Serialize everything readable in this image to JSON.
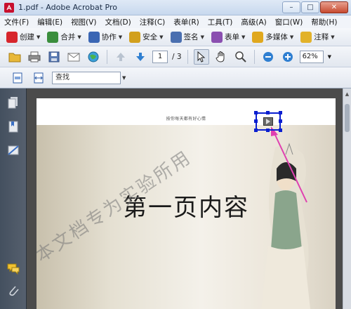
{
  "window": {
    "title": "1.pdf - Adobe Acrobat Pro",
    "minimize": "–",
    "maximize": "□",
    "close": "✕"
  },
  "menu": [
    "文件(F)",
    "编辑(E)",
    "视图(V)",
    "文档(D)",
    "注释(C)",
    "表单(R)",
    "工具(T)",
    "高级(A)",
    "窗口(W)",
    "帮助(H)"
  ],
  "tasks": [
    {
      "label": "创建",
      "icon": "create-icon",
      "color": "#d7262c"
    },
    {
      "label": "合并",
      "icon": "combine-icon",
      "color": "#3b8e3d"
    },
    {
      "label": "协作",
      "icon": "collaborate-icon",
      "color": "#3a66b4"
    },
    {
      "label": "安全",
      "icon": "lock-icon",
      "color": "#d2a01d"
    },
    {
      "label": "签名",
      "icon": "pen-icon",
      "color": "#4a6fb0"
    },
    {
      "label": "表单",
      "icon": "form-icon",
      "color": "#8a4fb0"
    },
    {
      "label": "多媒体",
      "icon": "multimedia-icon",
      "color": "#e0a81e"
    },
    {
      "label": "注释",
      "icon": "comment-icon",
      "color": "#e2b22a"
    }
  ],
  "nav": {
    "current_page": "1",
    "total_pages": "/ 3",
    "zoom": "62%"
  },
  "find": {
    "placeholder": "查找"
  },
  "document": {
    "header": "按你每天都有好心情",
    "title": "第一页内容",
    "watermark": "本文档专为实验所用"
  },
  "colors": {
    "accent": "#0b1fd0",
    "arrow": "#e040b0"
  }
}
